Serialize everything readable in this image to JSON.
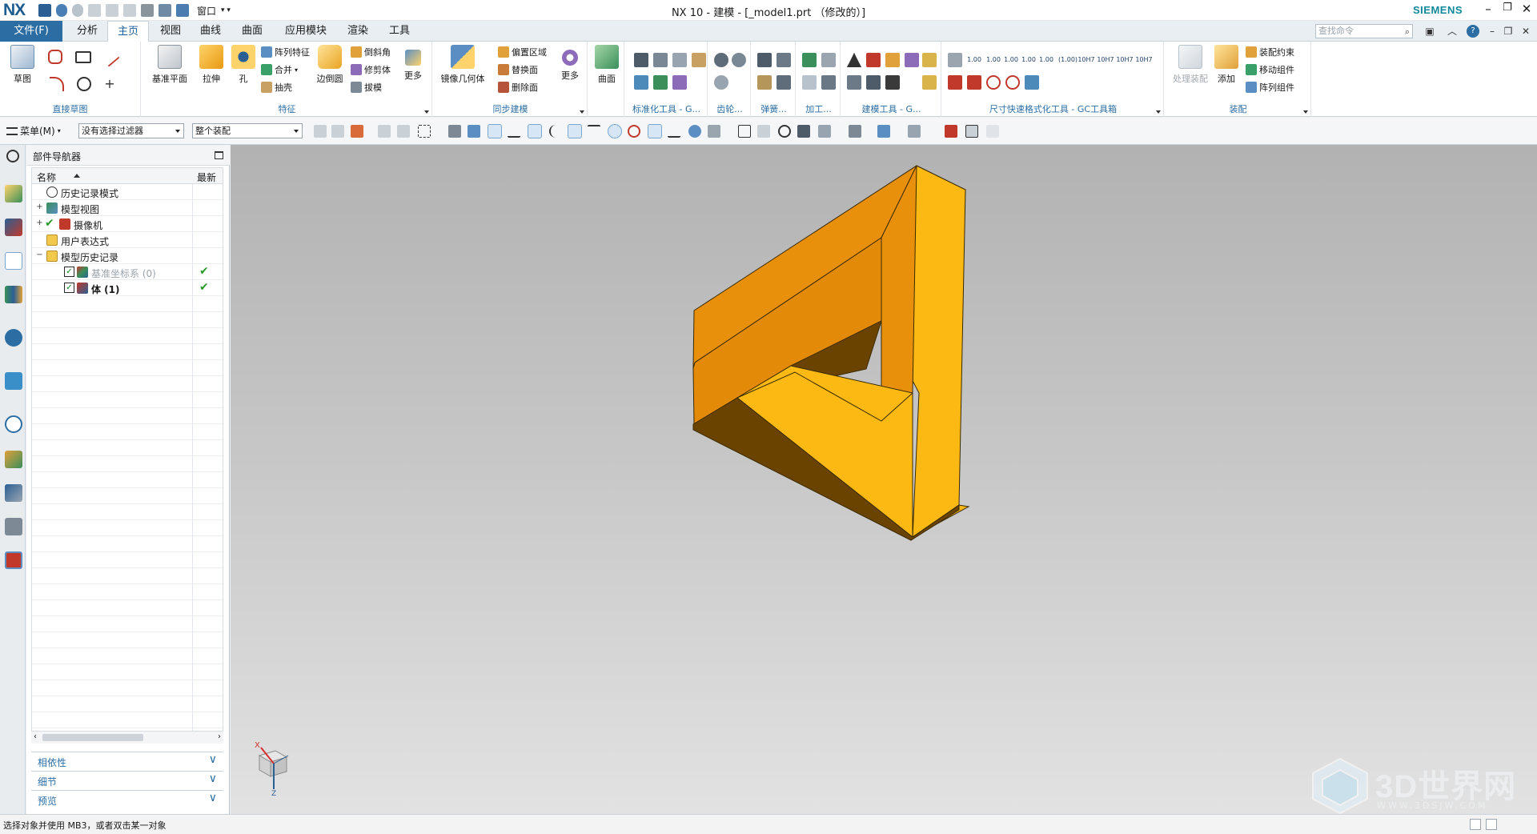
{
  "app": {
    "logo": "NX",
    "title": "NX 10 - 建模 - [_model1.prt （修改的）]",
    "brand": "SIEMENS",
    "window_menu": "窗口"
  },
  "tabs": {
    "file": "文件(F)",
    "items": [
      "分析",
      "主页",
      "视图",
      "曲线",
      "曲面",
      "应用模块",
      "渲染",
      "工具"
    ],
    "active": "主页"
  },
  "search": {
    "placeholder": "查找命令"
  },
  "ribbon": {
    "groups": {
      "direct_sketch": "直接草图",
      "feature": "特征",
      "sync": "同步建模",
      "std_tools": "标准化工具 - G...",
      "gear": "齿轮...",
      "spring": "弹簧...",
      "machining": "加工...",
      "modeling_tools": "建模工具 - G...",
      "dim_tools": "尺寸快速格式化工具 - GC工具箱",
      "assembly": "装配"
    },
    "sketch": "草图",
    "datum_plane": "基准平面",
    "extrude": "拉伸",
    "hole": "孔",
    "pattern_feature": "阵列特征",
    "unite": "合并",
    "shell": "抽壳",
    "edge_blend": "边倒圆",
    "chamfer": "倒斜角",
    "trim_body": "修剪体",
    "draft": "拔模",
    "more": "更多",
    "mirror_geometry": "镜像几何体",
    "offset_region": "偏置区域",
    "replace_face": "替换面",
    "delete_face": "删除面",
    "sync_more": "更多",
    "surface": "曲面",
    "process_assembly": "处理装配",
    "add": "添加",
    "assembly_constraints": "装配约束",
    "move_component": "移动组件",
    "pattern_component": "阵列组件",
    "dim_labels": [
      "1.00",
      "1.00",
      "1.00",
      "1.00",
      "1.00",
      "(1.00)",
      "10H7",
      "10H7",
      "10H7",
      "10H7",
      "10H7"
    ]
  },
  "selection_bar": {
    "menu": "菜单(M)",
    "filter": "没有选择过滤器",
    "scope": "整个装配"
  },
  "navigator": {
    "title": "部件导航器",
    "col_name": "名称",
    "col_latest": "最新",
    "rows": [
      {
        "label": "历史记录模式",
        "indent": 0,
        "expand": "",
        "checked": false,
        "latest": false
      },
      {
        "label": "模型视图",
        "indent": 0,
        "expand": "+",
        "checked": false,
        "latest": false
      },
      {
        "label": "摄像机",
        "indent": 0,
        "expand": "+",
        "checked": true,
        "latest": false
      },
      {
        "label": "用户表达式",
        "indent": 0,
        "expand": "",
        "checked": false,
        "latest": false
      },
      {
        "label": "模型历史记录",
        "indent": 0,
        "expand": "−",
        "checked": false,
        "latest": false
      },
      {
        "label": "基准坐标系 (0)",
        "indent": 1,
        "expand": "",
        "checked": true,
        "latest": true
      },
      {
        "label": "体 (1)",
        "indent": 1,
        "expand": "",
        "checked": true,
        "latest": true
      }
    ],
    "panels": [
      "相依性",
      "细节",
      "预览"
    ]
  },
  "triad": {
    "x": "X",
    "z": "Z"
  },
  "watermark": {
    "title": "3D世界网",
    "url": "WWW.3DSJW.COM"
  },
  "status": {
    "message": "选择对象并使用 MB3，或者双击某一对象"
  },
  "colors": {
    "accent": "#2c6ea3",
    "brand": "#0f8a9b",
    "part_light": "#fdb913",
    "part_mid": "#e8900c",
    "part_dark": "#6b4300"
  }
}
